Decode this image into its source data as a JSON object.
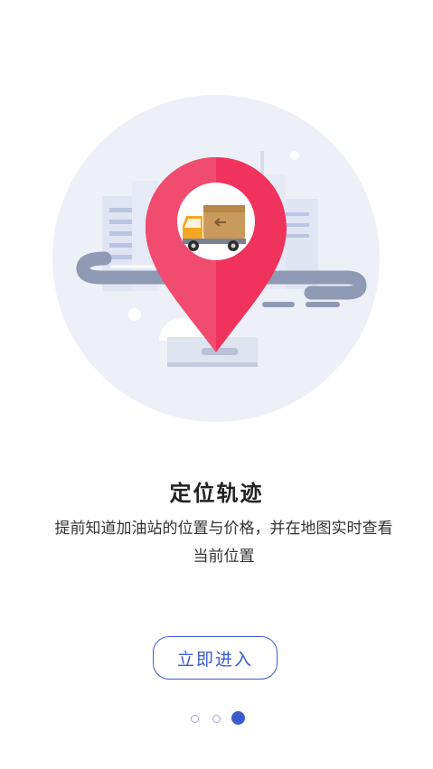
{
  "onboarding": {
    "title": "定位轨迹",
    "description": "提前知道加油站的位置与价格，并在地图实时查看当前位置",
    "enter_label": "立即进入",
    "page_total": 3,
    "active_page": 3
  },
  "colors": {
    "accent": "#3a5bd0",
    "pin": "#f0335c",
    "circle_bg": "#eef0f7"
  },
  "icons": {
    "pin": "location-pin-icon",
    "truck": "truck-icon"
  }
}
